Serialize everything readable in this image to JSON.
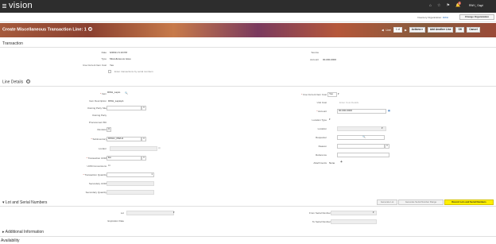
{
  "app": {
    "logo": "vision",
    "user": "RWH_ Gagri"
  },
  "topbar": {
    "notification_count": "4"
  },
  "org": {
    "label": "Inventory Organization",
    "value": "RWH",
    "change_button": "Change Organization"
  },
  "page": {
    "title": "Create Miscellaneous Transaction Line: 1",
    "nav_line_label": "Line",
    "line_value": "1 of",
    "actions": "Actions",
    "add_another_line": "Add Another Line",
    "ok": "OK",
    "cancel": "Cancel"
  },
  "transaction": {
    "heading": "Transaction",
    "date_label": "Date",
    "date_value": "6/28/21 6:19 PM",
    "type_label": "Type",
    "type_value": "Miscellaneous issue",
    "use_cost_label": "Use Current Item Cost",
    "use_cost_value": "Yes",
    "serial_checkbox_label": "Enter transactions by serial numbers",
    "source_label": "Source",
    "account_label": "Account",
    "account_value": "00-000-0000"
  },
  "line_details": {
    "heading": "Line Details",
    "item_label": "Item",
    "item_value": "RWH_Lapto",
    "item_desc_label": "Item Description",
    "item_desc_value": "RWH_Laptop1",
    "owning_party_site_label": "Owning Party Site",
    "owning_party_label": "Owning Party",
    "procurement_bu_label": "Procurement BU",
    "revision_label": "Revision",
    "subinventory_label": "Subinventory",
    "subinventory_value": "RWH1_RWH1",
    "locator_label": "Locator",
    "uom_label": "Transaction UOM",
    "uom_value": "Ea",
    "uom_conversions_label": "UOM Conversions",
    "quantity_label": "Transaction Quantity",
    "quantity_value": "1",
    "secondary_uom_label": "Secondary UOM",
    "secondary_qty_label": "Secondary Quantity",
    "use_cost_label": "Use Current Item Cost",
    "use_cost_value": "Yes",
    "unit_cost_label": "Unit Cost",
    "unit_cost_placeholder": "Enter Cost Details",
    "account_label": "Account",
    "account_value": "00-000-0000",
    "location_type_label": "Location Type",
    "location_label": "Location",
    "requester_label": "Requester",
    "reason_label": "Reason",
    "reference_label": "Reference",
    "attachments_label": "Attachments",
    "attachments_value": "None"
  },
  "lot_serial": {
    "heading": "Lot and Serial Numbers",
    "buttons": [
      "Generate Lot",
      "Generate Serial Number Range",
      "Record Lots and Serial Numbers"
    ],
    "lot_label": "Lot",
    "expiration_label": "Expiration Date",
    "from_serial_label": "From Serial Number",
    "to_serial_label": "To Serial Number"
  },
  "additional": {
    "heading": "Additional Information"
  },
  "availability": {
    "heading": "Availability"
  },
  "colors": {
    "highlight": "#ffef00",
    "link": "#2a6ebb",
    "topbar": "#2d2d2d"
  }
}
